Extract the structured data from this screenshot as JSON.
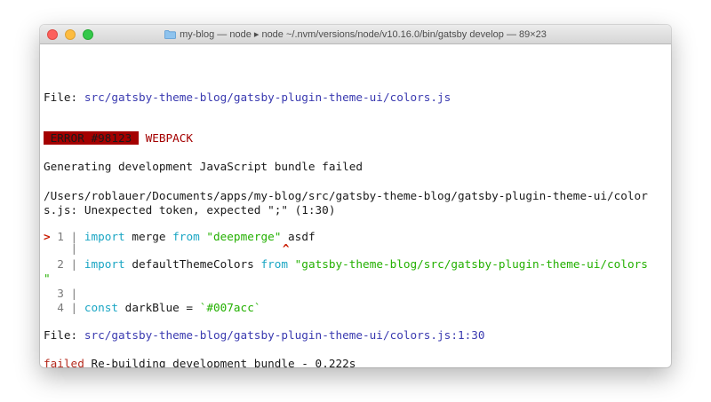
{
  "window": {
    "title": "my-blog — node ▸ node ~/.nvm/versions/node/v10.16.0/bin/gatsby develop — 89×23"
  },
  "terminal": {
    "file_label_1": "File: ",
    "file_path_1": "src/gatsby-theme-blog/gatsby-plugin-theme-ui/colors.js",
    "error_badge": " ERROR #98123 ",
    "error_category": "WEBPACK",
    "error_message": "Generating development JavaScript bundle failed",
    "error_location_line1": "/Users/roblauer/Documents/apps/my-blog/src/gatsby-theme-blog/gatsby-plugin-theme-ui/color",
    "error_location_line2": "s.js: Unexpected token, expected \";\" (1:30)",
    "code_lines": {
      "l1": {
        "marker": ">",
        "num": " 1 | ",
        "kw1": "import",
        "txt1": " merge ",
        "kw2": "from",
        "str": "\"deepmerge\"",
        "txt2": " asdf"
      },
      "l1b": {
        "gutter": "    | ",
        "caret": "^"
      },
      "l2": {
        "num": "  2 | ",
        "kw1": "import",
        "txt1": " defaultThemeColors ",
        "kw2": "from",
        "str": "\"gatsby-theme-blog/src/gatsby-plugin-theme-ui/colors"
      },
      "l2b": {
        "str": "\""
      },
      "l3": {
        "num": "  3 |"
      },
      "l4": {
        "num": "  4 | ",
        "kw1": "const",
        "txt1": " darkBlue = ",
        "str": "`#007acc`"
      }
    },
    "file_label_2": "File: ",
    "file_path_2": "src/gatsby-theme-blog/gatsby-plugin-theme-ui/colors.js:1:30",
    "failed_label": "failed",
    "failed_message": " Re-building development bundle - 0.222s"
  }
}
